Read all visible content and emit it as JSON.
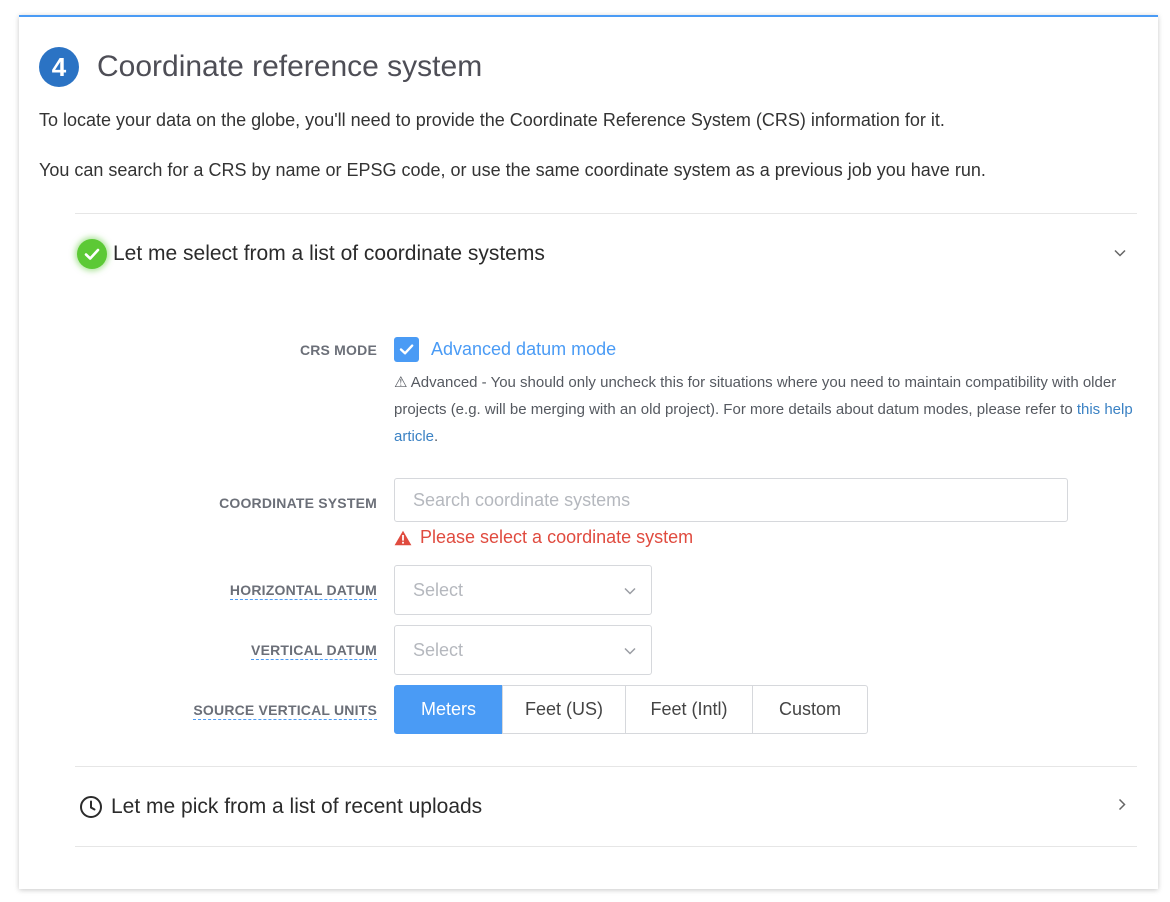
{
  "step": {
    "number": "4",
    "title": "Coordinate reference system"
  },
  "intro": {
    "line1": "To locate your data on the globe, you'll need to provide the Coordinate Reference System (CRS) information for it.",
    "line2": "You can search for a CRS by name or EPSG code, or use the same coordinate system as a previous job you have run."
  },
  "list_section": {
    "title": "Let me select from a list of coordinate systems",
    "status_icon": "check-circle-icon",
    "expanded": true
  },
  "crs_mode": {
    "label": "CRS MODE",
    "checkbox_label": "Advanced datum mode",
    "checked": true,
    "help_prefix": "⚠ Advanced - You should only uncheck this for situations where you need to maintain compatibility with older projects (e.g. will be merging with an old project). For more details about datum modes, please refer to ",
    "help_link": "this help article",
    "help_suffix": "."
  },
  "coordinate_system": {
    "label": "COORDINATE SYSTEM",
    "placeholder": "Search coordinate systems",
    "value": "",
    "error": "Please select a coordinate system"
  },
  "horizontal_datum": {
    "label": "HORIZONTAL DATUM",
    "value": "Select"
  },
  "vertical_datum": {
    "label": "VERTICAL DATUM",
    "value": "Select"
  },
  "source_vertical_units": {
    "label": "SOURCE VERTICAL UNITS",
    "options": [
      "Meters",
      "Feet (US)",
      "Feet (Intl)",
      "Custom"
    ],
    "selected": "Meters"
  },
  "recent_section": {
    "title": "Let me pick from a list of recent uploads",
    "icon": "clock-icon",
    "expanded": false
  },
  "colors": {
    "accent": "#4a9bf5",
    "step_badge": "#2b73c4",
    "success": "#5cc935",
    "error": "#e04b3f"
  }
}
